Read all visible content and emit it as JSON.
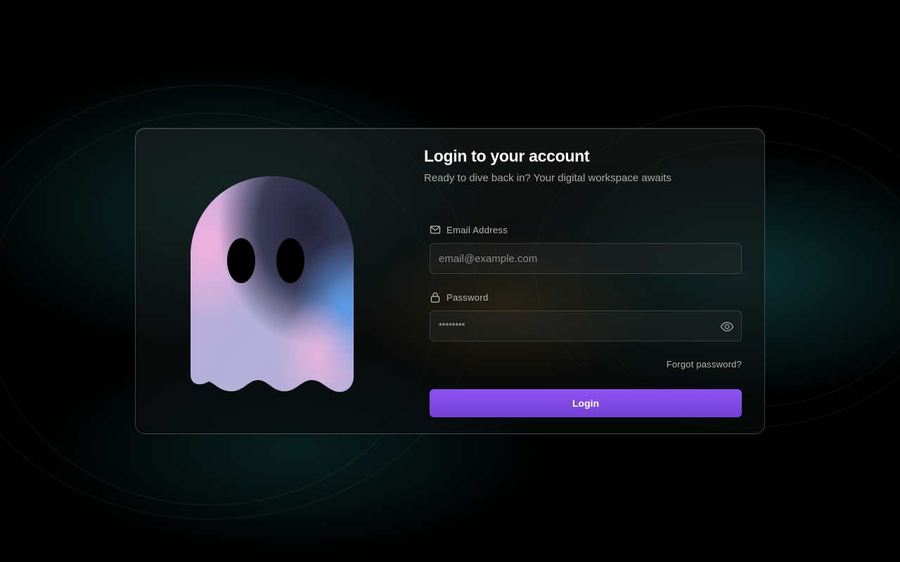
{
  "header": {
    "title": "Login to your account",
    "subtitle": "Ready to dive back in? Your digital workspace awaits"
  },
  "email": {
    "label": "Email Address",
    "placeholder": "email@example.com",
    "icon": "mail-icon"
  },
  "password": {
    "label": "Password",
    "value": "********",
    "icon": "lock-icon",
    "toggle_icon": "eye-icon"
  },
  "forgot_label": "Forgot password?",
  "login_label": "Login",
  "colors": {
    "accent": "#8b52f0",
    "background": "#000000",
    "text": "#ffffff",
    "muted": "#a8a8a8"
  }
}
